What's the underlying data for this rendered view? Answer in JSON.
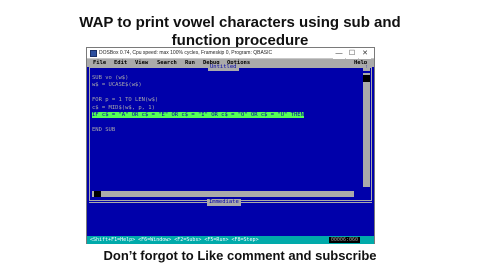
{
  "caption_top_line1": "WAP to print vowel characters using sub and",
  "caption_top_line2": "function procedure",
  "caption_bottom": "Don’t forgot to Like comment and subscribe",
  "window": {
    "title": "DOSBox 0.74, Cpu speed: max 100% cycles, Frameskip 0, Program: QBASIC",
    "controls": {
      "minimize": "—",
      "maximize": "☐",
      "close": "✕"
    }
  },
  "menu": {
    "items": [
      "File",
      "Edit",
      "View",
      "Search",
      "Run",
      "Debug",
      "Options"
    ],
    "help": "Help"
  },
  "editor": {
    "title": "Untitled",
    "scroll_up": "↑",
    "lines": [
      "SUB vo (w$)",
      "w$ = UCASE$(w$)",
      "",
      "FOR p = 1 TO LEN(w$)",
      "c$ = MID$(w$, p, 1)",
      "IF c$ = \"A\" OR c$ = \"E\" OR c$ = \"I\" OR c$ = \"O\" OR c$ = \"U\" THEN",
      "",
      "END SUB"
    ],
    "highlight_line": 5
  },
  "immediate": {
    "title": "Immediate"
  },
  "status": {
    "shortcuts": "<Shift+F1=Help> <F6=Window> <F2=Subs> <F5=Run> <F8=Step>",
    "position": "00006:060"
  },
  "colors": {
    "editor_bg": "#0000aa",
    "editor_fg": "#aaaaaa",
    "menu_bg": "#aaaaaa",
    "highlight": "#55ff55",
    "status_bg": "#00aaaa"
  }
}
